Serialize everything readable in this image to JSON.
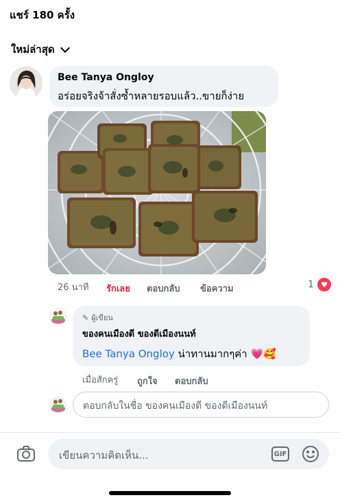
{
  "header": {
    "share_count": "แชร์ 180 ครั้ง",
    "sort_label": "ใหม่ล่าสุด"
  },
  "comment": {
    "author": "Bee Tanya Ongloy",
    "text": "อร่อยจริงจ้าสั่งซ้ำหลายรอบแล้ว..ขายก็ง่าย",
    "time": "26 นาที",
    "love": "รักเลย",
    "reply": "ตอบกลับ",
    "message": "ข้อความ",
    "reaction_count": "1"
  },
  "reply": {
    "author_tag": "ผู้เขียน",
    "page_name": "ของคนเมืองดี ของดีเมืองนนท์",
    "mention": "Bee Tanya Ongloy",
    "text": "น่าทานมากๆค่า 💗🥰",
    "time": "เมื่อสักครู่",
    "like": "ถูกใจ",
    "reply": "ตอบกลับ"
  },
  "reply_input": {
    "placeholder": "ตอบกลับในชื่อ ของคนเมืองดี ของดีเมืองนนท์"
  },
  "composer": {
    "placeholder": "เขียนความคิดเห็น...",
    "gif": "GIF"
  },
  "colors": {
    "accent": "#216fdb",
    "love": "#e41e3f",
    "bubble": "#f0f2f5"
  }
}
